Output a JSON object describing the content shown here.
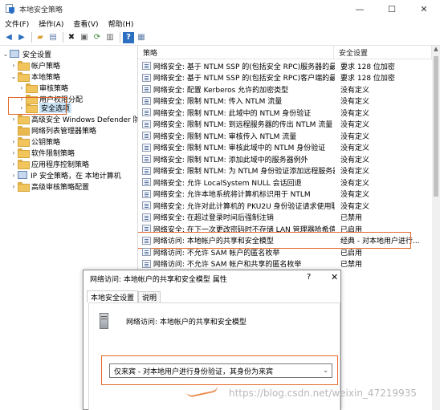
{
  "window": {
    "title": "本地安全策略",
    "controls": {
      "minimize": "—",
      "maximize": "☐",
      "close": "✕"
    }
  },
  "menu": [
    "文件(F)",
    "操作(A)",
    "查看(V)",
    "帮助(H)"
  ],
  "toolbar": {
    "icons": [
      "back-arrow-icon",
      "forward-arrow-icon",
      "up-folder-icon",
      "show-hide-tree-icon",
      "delete-icon",
      "properties-icon",
      "refresh-icon",
      "export-list-icon",
      "help-icon",
      "show-panel-icon"
    ]
  },
  "tree": {
    "items": [
      {
        "label": "安全设置",
        "toggle": "⌄"
      },
      {
        "label": "帐户策略",
        "toggle": "›"
      },
      {
        "label": "本地策略",
        "toggle": "⌄"
      },
      {
        "label": "审核策略",
        "toggle": "›"
      },
      {
        "label": "用户权限分配",
        "toggle": "›"
      },
      {
        "label": "安全选项",
        "toggle": "›"
      },
      {
        "label": "高级安全 Windows Defender 防火墙",
        "toggle": "›"
      },
      {
        "label": "网络列表管理器策略",
        "toggle": ""
      },
      {
        "label": "公钥策略",
        "toggle": "›"
      },
      {
        "label": "软件限制策略",
        "toggle": "›"
      },
      {
        "label": "应用程序控制策略",
        "toggle": "›"
      },
      {
        "label": "IP 安全策略，在 本地计算机",
        "toggle": "›"
      },
      {
        "label": "高级审核策略配置",
        "toggle": "›"
      }
    ]
  },
  "list": {
    "columns": {
      "name": "策略",
      "setting": "安全设置"
    },
    "rows": [
      {
        "name": "网络安全: 基于 NTLM SSP 的(包括安全 RPC)服务器的最小...",
        "setting": "要求 128 位加密"
      },
      {
        "name": "网络安全: 基于 NTLM SSP 的(包括安全 RPC)客户端的最小...",
        "setting": "要求 128 位加密"
      },
      {
        "name": "网络安全: 配置 Kerberos 允许的加密类型",
        "setting": "没有定义"
      },
      {
        "name": "网络安全: 限制 NTLM: 传入 NTLM 流量",
        "setting": "没有定义"
      },
      {
        "name": "网络安全: 限制 NTLM: 此域中的 NTLM 身份验证",
        "setting": "没有定义"
      },
      {
        "name": "网络安全: 限制 NTLM: 到远程服务器的传出 NTLM 流量",
        "setting": "没有定义"
      },
      {
        "name": "网络安全: 限制 NTLM: 审核传入 NTLM 流量",
        "setting": "没有定义"
      },
      {
        "name": "网络安全: 限制 NTLM: 审核此域中的 NTLM 身份验证",
        "setting": "没有定义"
      },
      {
        "name": "网络安全: 限制 NTLM: 添加此域中的服务器例外",
        "setting": "没有定义"
      },
      {
        "name": "网络安全: 限制 NTLM: 为 NTLM 身份验证添加远程服务器...",
        "setting": "没有定义"
      },
      {
        "name": "网络安全: 允许 LocalSystem NULL 会话回退",
        "setting": "没有定义"
      },
      {
        "name": "网络安全: 允许本地系统将计算机标识用于 NTLM",
        "setting": "没有定义"
      },
      {
        "name": "网络安全: 允许对此计算机的 PKU2U 身份验证请求使用联...",
        "setting": "没有定义"
      },
      {
        "name": "网络安全: 在超过登录时间后强制注销",
        "setting": "已禁用"
      },
      {
        "name": "网络安全: 在下一次更改密码时不存储 LAN 管理器哈希值",
        "setting": "已启用"
      },
      {
        "name": "网络访问: 本地帐户的共享和安全模型",
        "setting": "经典 - 对本地用户进行..."
      },
      {
        "name": "网络访问: 不允许 SAM 帐户的匿名枚举",
        "setting": "已启用"
      },
      {
        "name": "网络访问: 不允许 SAM 帐户和共享的匿名枚举",
        "setting": "已禁用"
      }
    ]
  },
  "dialog": {
    "title": "网络访问: 本地帐户的共享和安全模型 属性",
    "help": "?",
    "close": "✕",
    "tabs": [
      "本地安全设置",
      "说明"
    ],
    "policy_name": "网络访问: 本地帐户的共享和安全模型",
    "selected_option": "仅来宾 - 对本地用户进行身份验证，其身份为来宾",
    "dropdown_arrow": "⌄"
  },
  "watermark": "https://blog.csdn.net/weixin_47219935",
  "colors": {
    "highlight": "#e26a2c",
    "selection": "#cce4f7"
  }
}
